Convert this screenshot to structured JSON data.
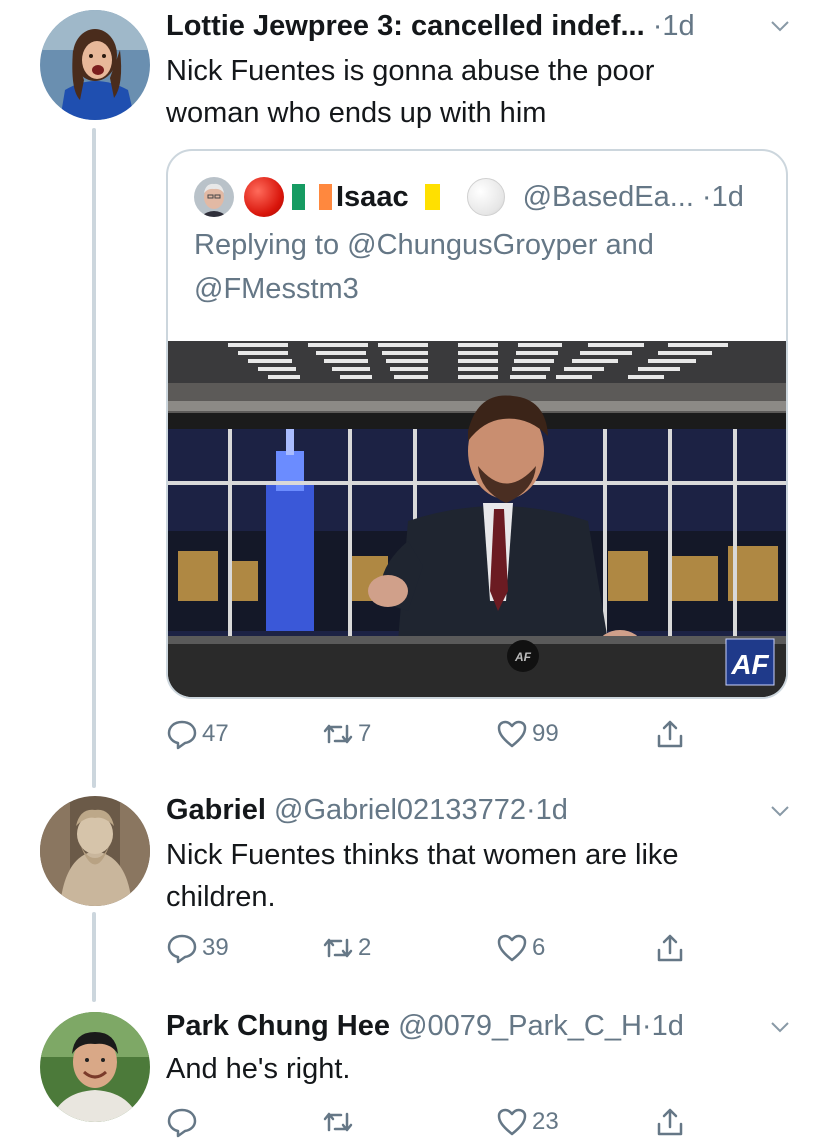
{
  "tweets": [
    {
      "name": "Lottie Jewpree 3: cancelled indef...",
      "handle": "",
      "separator": "·",
      "time": "1d",
      "text": "Nick Fuentes is gonna abuse the poor woman who ends up with him",
      "avatar_icon": "girl-avatar",
      "quote": {
        "name": "Isaac",
        "handle": "@BasedEa...",
        "separator": "·",
        "time": "1d",
        "reply_prefix": "Replying to",
        "reply_mention_1": "@ChungusGroyper",
        "reply_and": "and",
        "reply_mention_2": "@FMesstm3",
        "emojis": [
          "red-circle",
          "ireland-flag",
          "vatican-flag",
          "white-circle"
        ],
        "media": {
          "type": "video-still",
          "logo_text": "AF"
        }
      },
      "actions": {
        "replies": "47",
        "retweets": "7",
        "likes": "99"
      }
    },
    {
      "name": "Gabriel",
      "handle": "@Gabriel02133772",
      "separator": "·",
      "time": "1d",
      "text": "Nick Fuentes thinks that women are like children.",
      "avatar_icon": "statue-avatar",
      "actions": {
        "replies": "39",
        "retweets": "2",
        "likes": "6"
      }
    },
    {
      "name": "Park Chung Hee",
      "handle": "@0079_Park_C_H",
      "separator": "·",
      "time": "1d",
      "text": "And he's right.",
      "avatar_icon": "man-avatar",
      "actions": {
        "replies": "",
        "retweets": "",
        "likes": "23"
      }
    }
  ],
  "colors": {
    "text": "#14171a",
    "secondary": "#657786",
    "border": "#ccd6dd"
  }
}
